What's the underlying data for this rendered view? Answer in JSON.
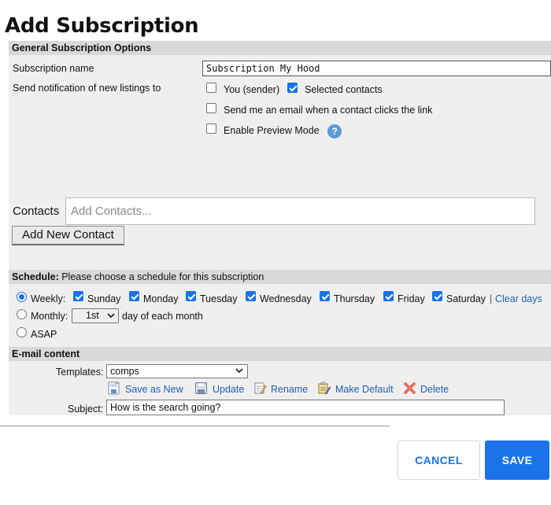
{
  "title": "Add Subscription",
  "general": {
    "header": "General Subscription Options",
    "subscription_name_label": "Subscription name",
    "subscription_name_value": "Subscription My Hood",
    "notify_label": "Send notification of new listings to",
    "you_sender": "You (sender)",
    "selected_contacts": "Selected contacts",
    "email_on_click": "Send me an email when a contact clicks the link",
    "preview_mode": "Enable Preview Mode",
    "help_glyph": "?",
    "contacts_label": "Contacts",
    "contacts_placeholder": "Add Contacts...",
    "add_new_contact": "Add New Contact",
    "you_sender_checked": false,
    "selected_contacts_checked": true,
    "email_on_click_checked": false,
    "preview_mode_checked": false
  },
  "schedule": {
    "header_bold": "Schedule:",
    "header_rest": " Please choose a schedule for this subscription",
    "weekly": "Weekly:",
    "monthly": "Monthly:",
    "asap": "ASAP",
    "selected": "weekly",
    "days": [
      {
        "label": "Sunday",
        "checked": true
      },
      {
        "label": "Monday",
        "checked": true
      },
      {
        "label": "Tuesday",
        "checked": true
      },
      {
        "label": "Wednesday",
        "checked": true
      },
      {
        "label": "Thursday",
        "checked": true
      },
      {
        "label": "Friday",
        "checked": true
      },
      {
        "label": "Saturday",
        "checked": true
      }
    ],
    "separator": "|",
    "clear_days": "Clear days",
    "monthly_value": "1st",
    "monthly_suffix": "day of each month"
  },
  "email": {
    "header": "E-mail content",
    "templates_label": "Templates:",
    "template_value": "comps",
    "actions": {
      "save_as_new": "Save as New",
      "update": "Update",
      "rename": "Rename",
      "make_default": "Make Default",
      "delete": "Delete"
    },
    "subject_label": "Subject:",
    "subject_value": "How is the search going?"
  },
  "footer": {
    "cancel": "CANCEL",
    "save": "SAVE"
  },
  "colors": {
    "accent": "#1a73e8",
    "link": "#1f5fb3",
    "panel": "#efefef",
    "section_header": "#d9d9d9"
  }
}
